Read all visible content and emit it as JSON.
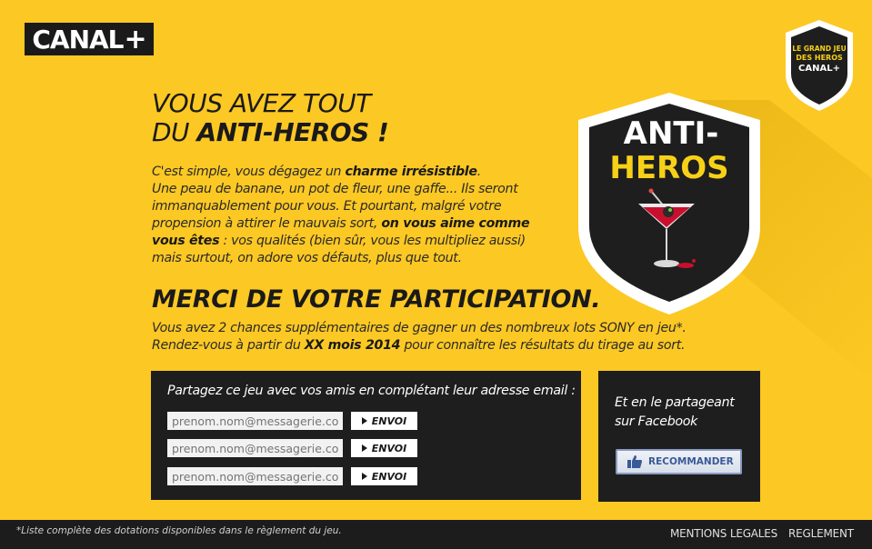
{
  "brand": {
    "logo_text": "CANAL",
    "logo_plus": "+"
  },
  "badge": {
    "line1": "LE GRAND JEU",
    "line2": "DES HEROS",
    "line3": "CANAL+"
  },
  "shield": {
    "line1": "ANTI-",
    "line2": "HEROS"
  },
  "headline": {
    "line1": "VOUS AVEZ TOUT",
    "line2_prefix": "DU ",
    "line2_strong": "ANTI-HEROS !"
  },
  "intro": {
    "p1": "C'est simple, vous dégagez un ",
    "b1": "charme irrésistible",
    "p2": ".",
    "p3": "Une peau de banane, un pot de fleur, une gaffe...  Ils seront immanquablement pour vous. Et pourtant, malgré votre propension à attirer le mauvais sort, ",
    "b2": "on vous aime comme vous êtes",
    "p4": " : vos qualités (bien sûr, vous les multipliez aussi) mais surtout, on adore vos défauts, plus que tout."
  },
  "merci": "MERCI DE VOTRE PARTICIPATION.",
  "chances": {
    "line1": "Vous avez 2 chances supplémentaires de gagner un des nombreux lots SONY en jeu*.",
    "line2_prefix": "Rendez-vous à partir du ",
    "line2_strong": "XX mois 2014",
    "line2_suffix": " pour connaître les résultats du tirage au sort."
  },
  "share": {
    "title": "Partagez ce jeu avec vos amis en complétant leur adresse email :",
    "rows": [
      {
        "placeholder": "prenom.nom@messagerie.com",
        "button": "ENVOI"
      },
      {
        "placeholder": "prenom.nom@messagerie.com",
        "button": "ENVOI"
      },
      {
        "placeholder": "prenom.nom@messagerie.com",
        "button": "ENVOI"
      }
    ]
  },
  "facebook": {
    "text": "Et en le partageant sur Facebook",
    "button": "RECOMMANDER"
  },
  "footer": {
    "note": "*Liste complète des dotations disponibles dans le règlement du jeu.",
    "links": [
      "MENTIONS LEGALES",
      "REGLEMENT"
    ]
  },
  "colors": {
    "background": "#fcc823",
    "dark": "#1e1e1e",
    "accent_yellow": "#f7d117",
    "facebook_blue": "#3b5998"
  }
}
